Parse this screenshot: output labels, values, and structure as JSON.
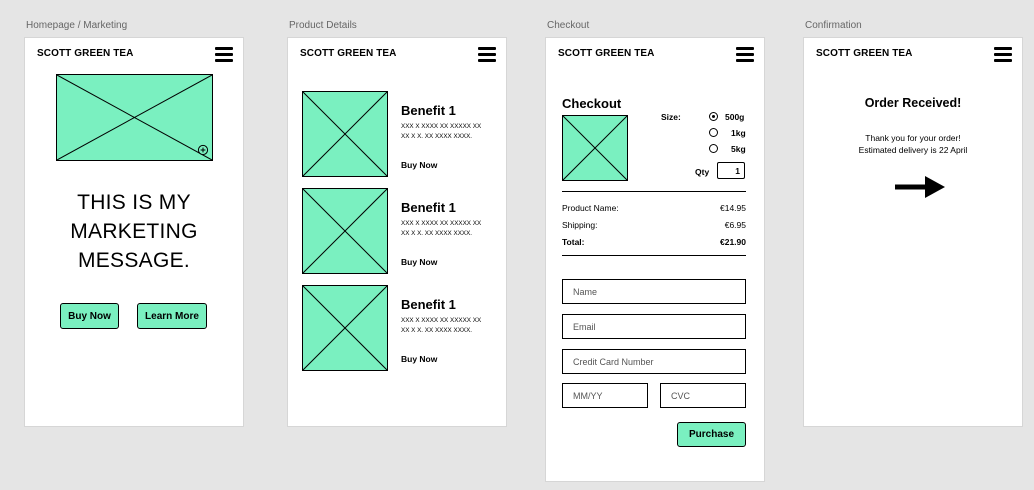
{
  "frames": {
    "home": {
      "label": "Homepage / Marketing"
    },
    "product": {
      "label": "Product Details"
    },
    "checkout": {
      "label": "Checkout"
    },
    "confirm": {
      "label": "Confirmation"
    }
  },
  "brand": "SCOTT GREEN TEA",
  "home": {
    "message_line1": "THIS IS MY",
    "message_line2": "MARKETING",
    "message_line3": "MESSAGE.",
    "buy_now": "Buy Now",
    "learn_more": "Learn More"
  },
  "product": {
    "benefits": [
      {
        "title": "Benefit 1",
        "body": "XXX X XXXX XX XXXXX XX XX X X.  XX XXXX XXXX.",
        "buy": "Buy Now"
      },
      {
        "title": "Benefit 1",
        "body": "XXX X XXXX XX XXXXX XX XX X X.  XX XXXX XXXX.",
        "buy": "Buy Now"
      },
      {
        "title": "Benefit 1",
        "body": "XXX X XXXX XX XXXXX XX XX X X.  XX XXXX XXXX.",
        "buy": "Buy Now"
      }
    ]
  },
  "checkout": {
    "title": "Checkout",
    "size_label": "Size:",
    "sizes": [
      {
        "label": "500g",
        "selected": true
      },
      {
        "label": "1kg",
        "selected": false
      },
      {
        "label": "5kg",
        "selected": false
      }
    ],
    "qty_label": "Qty",
    "qty_value": "1",
    "product_name_label": "Product Name:",
    "product_name_value": "€14.95",
    "shipping_label": "Shipping:",
    "shipping_value": "€6.95",
    "total_label": "Total:",
    "total_value": "€21.90",
    "name_placeholder": "Name",
    "email_placeholder": "Email",
    "card_placeholder": "Credit Card Number",
    "expiry_placeholder": "MM/YY",
    "cvc_placeholder": "CVC",
    "purchase": "Purchase"
  },
  "confirm": {
    "title": "Order Received!",
    "line1": "Thank you for your order!",
    "line2": "Estimated delivery is 22 April"
  },
  "colors": {
    "accent": "#7af0c0",
    "background": "#e5e5e5"
  }
}
